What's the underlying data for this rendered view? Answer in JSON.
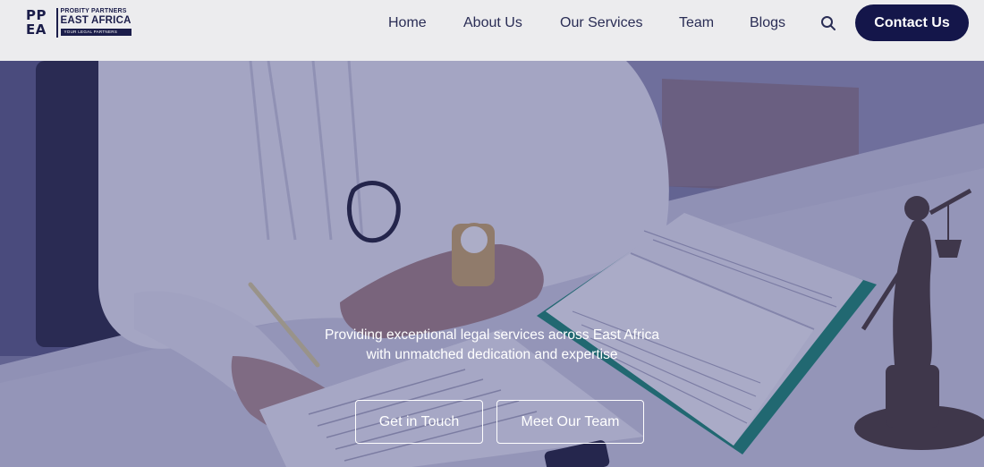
{
  "brand": {
    "mark_line1": "PP",
    "mark_line2": "EA",
    "name_small": "PROBITY PARTNERS",
    "name_big": "EAST AFRICA",
    "tagline": "YOUR LEGAL PARTNERS"
  },
  "nav": {
    "items": [
      "Home",
      "About Us",
      "Our Services",
      "Team",
      "Blogs"
    ],
    "search_icon": "search-icon",
    "contact_label": "Contact Us"
  },
  "hero": {
    "line1": "Providing exceptional legal services across East Africa",
    "line2": "with unmatched dedication and expertise",
    "primary_button": "Get in Touch",
    "secondary_button": "Meet Our Team"
  },
  "colors": {
    "brand_navy": "#14164a",
    "header_bg": "#ececee",
    "overlay_tint": "#26286e"
  }
}
